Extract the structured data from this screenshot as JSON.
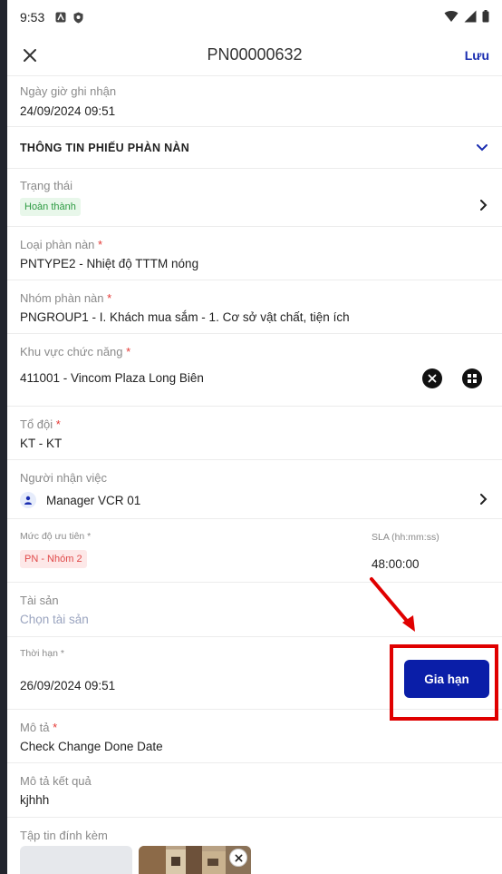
{
  "status_bar": {
    "time": "9:53"
  },
  "app_bar": {
    "title": "PN00000632",
    "save_label": "Lưu"
  },
  "fields": {
    "recorded_time": {
      "label": "Ngày giờ ghi nhận",
      "value": "24/09/2024 09:51"
    },
    "section": {
      "title": "THÔNG TIN PHIẾU PHÀN NÀN"
    },
    "status": {
      "label": "Trạng thái",
      "value": "Hoàn thành"
    },
    "complaint_type": {
      "label": "Loại phàn nàn",
      "value": "PNTYPE2 - Nhiệt độ TTTM nóng"
    },
    "complaint_group": {
      "label": "Nhóm phàn nàn",
      "value": "PNGROUP1 - I. Khách mua sắm - 1. Cơ sở vật chất, tiện ích"
    },
    "function_area": {
      "label": "Khu vực chức năng",
      "value": "411001 - Vincom Plaza Long Biên"
    },
    "team": {
      "label": "Tổ đội",
      "value": "KT - KT"
    },
    "assignee": {
      "label": "Người nhận việc",
      "value": "Manager VCR 01"
    },
    "priority": {
      "label": "Mức độ ưu tiên",
      "value": "PN - Nhóm 2"
    },
    "sla": {
      "label": "SLA (hh:mm:ss)",
      "value": "48:00:00"
    },
    "asset": {
      "label": "Tài sản",
      "placeholder": "Chọn tài sản"
    },
    "deadline": {
      "label": "Thời hạn",
      "value": "26/09/2024 09:51",
      "extend_label": "Gia hạn"
    },
    "description": {
      "label": "Mô tả",
      "value": "Check Change Done Date"
    },
    "result_description": {
      "label": "Mô tả kết quả",
      "value": "kjhhh"
    },
    "attachments": {
      "label": "Tập tin đính kèm"
    }
  },
  "colors": {
    "accent": "#0a1ea8",
    "highlight": "#e00000",
    "status_green": "#2e9b43",
    "priority_red": "#e04a4a"
  }
}
